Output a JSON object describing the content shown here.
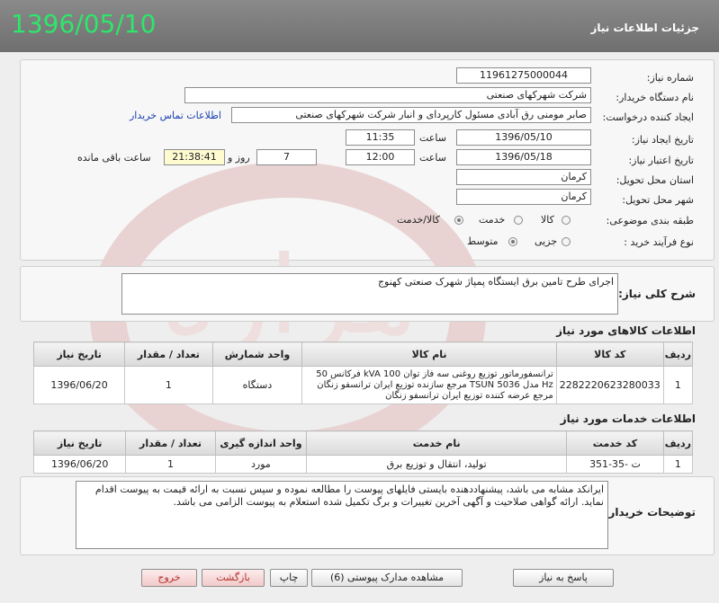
{
  "header": {
    "title": "جزئیات اطلاعات نیاز",
    "date_badge": "1396/05/10"
  },
  "form": {
    "need_number_label": "شماره نیاز:",
    "need_number": "11961275000044",
    "buyer_org_label": "نام دستگاه خریدار:",
    "buyer_org": "شرکت شهرکهای صنعتی",
    "requester_label": "ایجاد کننده درخواست:",
    "requester": "صابر مومنی رق آبادی مسئول کارپردای و انبار شرکت شهرکهای صنعتی",
    "contact_link": "اطلاعات تماس خریدار",
    "created_label": "تاریخ ایجاد نیاز:",
    "created_date": "1396/05/10",
    "time_label": "ساعت",
    "created_time": "11:35",
    "validity_label": "تاریخ اعتبار نیاز:",
    "validity_date": "1396/05/18",
    "validity_time": "12:00",
    "days": "7",
    "days_label": "روز و",
    "remaining_time": "21:38:41",
    "remaining_label": "ساعت باقی مانده",
    "province_label": "استان محل تحویل:",
    "province": "کرمان",
    "city_label": "شهر محل تحویل:",
    "city": "کرمان",
    "category_label": "طبقه بندی موضوعی:",
    "category_options": [
      "کالا",
      "خدمت",
      "کالا/خدمت"
    ],
    "category_selected_index": 2,
    "process_label": "نوع فرآیند خرید :",
    "process_options": [
      "جزیی",
      "متوسط"
    ],
    "process_selected_index": 1
  },
  "summary": {
    "label": "شرح کلی نیاز:",
    "text": "اجرای طرح تامین برق ایستگاه پمپاژ شهرک صنعتی کهنوج"
  },
  "goods": {
    "title": "اطلاعات کالاهای مورد نیاز",
    "columns": [
      "ردیف",
      "کد کالا",
      "نام کالا",
      "واحد شمارش",
      "تعداد / مقدار",
      "تاریخ نیاز"
    ],
    "rows": [
      {
        "row": "1",
        "code": "2282220623280033",
        "name": "ترانسفورماتور توزیع روغنی سه فاز توان 100 kVA فرکانس 50 Hz مدل TSUN 5036 مرجع سازنده توزیع ایران ترانسفو زنگان مرجع عرضه کننده توزیع ایران ترانسفو زنگان",
        "unit": "دستگاه",
        "qty": "1",
        "date": "1396/06/20"
      }
    ]
  },
  "services": {
    "title": "اطلاعات خدمات مورد نیاز",
    "columns": [
      "ردیف",
      "کد خدمت",
      "نام خدمت",
      "واحد اندازه گیری",
      "تعداد / مقدار",
      "تاریخ نیاز"
    ],
    "rows": [
      {
        "row": "1",
        "code": "ت -35-351",
        "name": "تولید، انتقال و توزیع برق",
        "unit": "مورد",
        "qty": "1",
        "date": "1396/06/20"
      }
    ]
  },
  "buyer_notes": {
    "label": "توضیحات خریدار:",
    "text": "ایرانکد مشابه می باشد، پیشنهاددهنده بایستی فایلهای پیوست را مطالعه نموده و سپس نسبت به ارائه قیمت به پیوست اقدام نماید. ارائه گواهی صلاحیت و آگهی آخرین تغییرات و برگ تکمیل شده استعلام به پیوست الزامی می باشد."
  },
  "buttons": {
    "reply": "پاسخ به نیاز",
    "attachments": "مشاهده مدارک پیوستی (6)",
    "print": "چاپ",
    "back": "بازگشت",
    "exit": "خروج"
  },
  "watermark_text": "هزاره",
  "colors": {
    "header_bg": "#7b7b7b",
    "date_badge": "#2ee66b",
    "link": "#1a3fb0",
    "exit_button_text": "#b0302b"
  }
}
